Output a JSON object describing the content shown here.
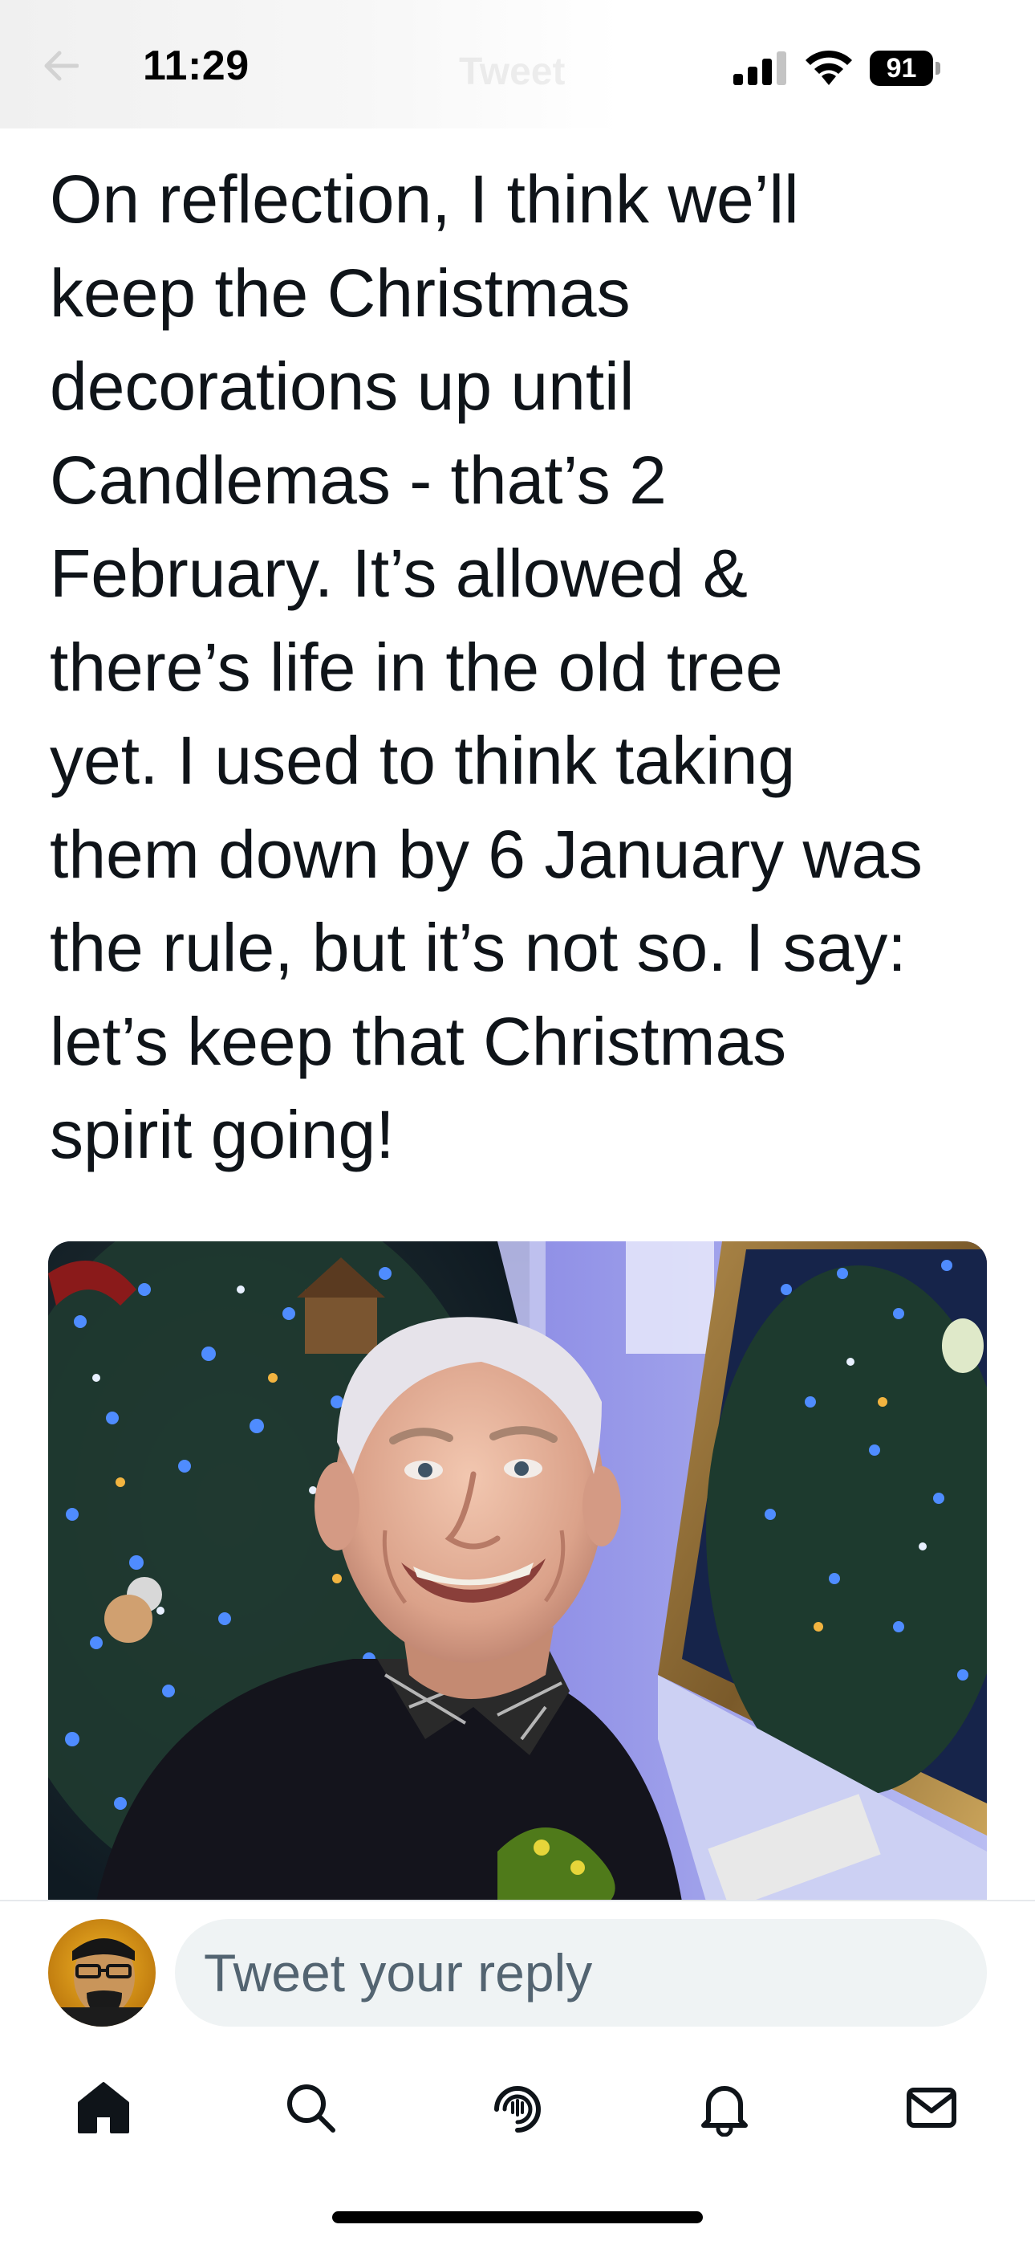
{
  "status_bar": {
    "time": "11:29",
    "battery_level": "91",
    "header_title": "Tweet"
  },
  "tweet": {
    "text": "On reflection, I think we’ll\nkeep the Christmas\ndecorations up until\nCandlemas - that’s 2\nFebruary. It’s allowed &\nthere’s life in the old tree\nyet. I used to think taking\nthem down by 6 January was\nthe rule, but it’s not so. I say:\nlet’s keep that Christmas\nspirit going!"
  },
  "reply": {
    "placeholder": "Tweet your reply"
  },
  "tab_bar": {
    "items": [
      {
        "icon": "home-icon",
        "active": true
      },
      {
        "icon": "search-icon",
        "active": false
      },
      {
        "icon": "spaces-icon",
        "active": false
      },
      {
        "icon": "notifications-icon",
        "active": false
      },
      {
        "icon": "messages-icon",
        "active": false
      }
    ]
  },
  "colors": {
    "text": "#0f1419",
    "secondary_text": "#536471",
    "reply_field": "#eff3f4",
    "divider": "#e6e9ec"
  }
}
